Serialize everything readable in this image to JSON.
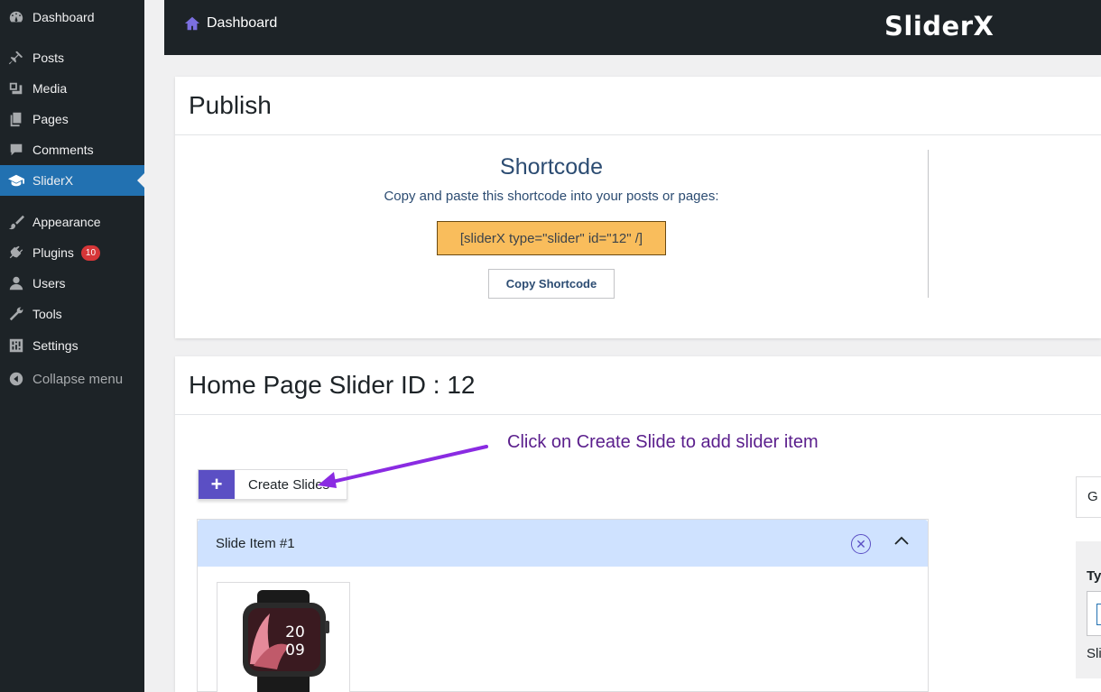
{
  "sidebar": {
    "items": [
      {
        "label": "Dashboard",
        "icon": "dashboard-icon"
      },
      {
        "label": "Posts",
        "icon": "pin-icon"
      },
      {
        "label": "Media",
        "icon": "media-icon"
      },
      {
        "label": "Pages",
        "icon": "pages-icon"
      },
      {
        "label": "Comments",
        "icon": "comment-icon"
      },
      {
        "label": "SliderX",
        "icon": "mortarboard-icon",
        "active": true
      },
      {
        "label": "Appearance",
        "icon": "brush-icon"
      },
      {
        "label": "Plugins",
        "icon": "plug-icon",
        "badge": "10"
      },
      {
        "label": "Users",
        "icon": "user-icon"
      },
      {
        "label": "Tools",
        "icon": "wrench-icon"
      },
      {
        "label": "Settings",
        "icon": "settings-icon"
      },
      {
        "label": "Collapse menu",
        "icon": "collapse-icon"
      }
    ]
  },
  "topbar": {
    "breadcrumb": "Dashboard",
    "brand": "SliderX"
  },
  "publish": {
    "title": "Publish",
    "shortcode_title": "Shortcode",
    "shortcode_desc": "Copy and paste this shortcode into your posts or pages:",
    "shortcode": "[sliderX type=\"slider\" id=\"12\" /]",
    "copy_button": "Copy Shortcode"
  },
  "slider": {
    "title": "Home Page Slider ID : 12",
    "annotation": "Click on Create Slide to add slider item",
    "create_button": "Create Slides",
    "slide_item_title": "Slide Item #1",
    "right_tab_label": "G",
    "right_type_label": "Ty",
    "right_sli_label": "Sli"
  },
  "colors": {
    "sidebar_bg": "#1d2327",
    "active": "#2271b1",
    "accent_purple": "#5b4fc4",
    "shortcode_bg": "#f9bd5c",
    "slide_head_bg": "#cfe2ff",
    "annotation": "#5a1e8c"
  }
}
